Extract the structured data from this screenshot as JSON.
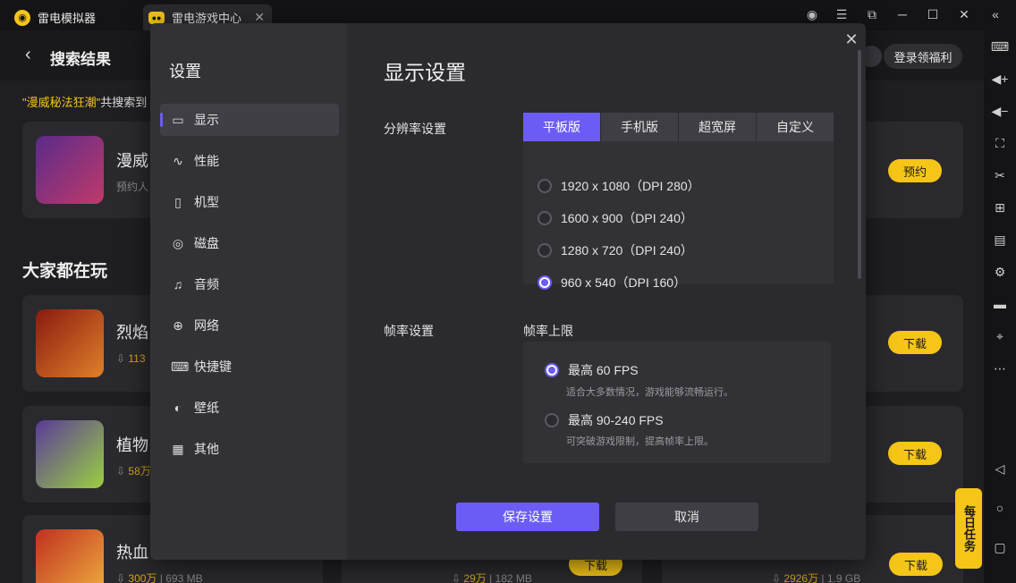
{
  "titlebar": {
    "app_tab": "雷电模拟器",
    "game_tab": "雷电游戏中心",
    "close_glyph": "✕",
    "controls": [
      "account-icon",
      "menu-icon",
      "restore-icon",
      "minimize-icon",
      "maximize-icon",
      "close-icon",
      "collapse-icon"
    ]
  },
  "background": {
    "header_title": "搜索结果",
    "login_label": "登录领福利",
    "search_info_keyword": "\"漫威秘法狂潮\"",
    "search_info_text": "共搜索到",
    "section_title": "大家都在玩",
    "apps": [
      {
        "name": "漫威",
        "sub": "预约人",
        "button": "预约"
      },
      {
        "name": "烈焰",
        "downloads": "113",
        "button": "下载"
      },
      {
        "name": "植物",
        "downloads": "58万",
        "button": "下载"
      },
      {
        "name": "热血",
        "downloads": "300万",
        "size": "693 MB"
      }
    ],
    "bottom_row": [
      {
        "downloads": "29万",
        "size": "182 MB",
        "button": "下载"
      },
      {
        "downloads": "2926万",
        "size": "1.9 GB",
        "button": "下载"
      }
    ],
    "daily_badge": "每日任务"
  },
  "dialog": {
    "sidebar_title": "设置",
    "nav": [
      {
        "label": "显示",
        "icon": "monitor-icon",
        "glyph": "▭"
      },
      {
        "label": "性能",
        "icon": "performance-icon",
        "glyph": "∿"
      },
      {
        "label": "机型",
        "icon": "device-icon",
        "glyph": "▯"
      },
      {
        "label": "磁盘",
        "icon": "disk-icon",
        "glyph": "◎"
      },
      {
        "label": "音频",
        "icon": "audio-icon",
        "glyph": "♫"
      },
      {
        "label": "网络",
        "icon": "globe-icon",
        "glyph": "⊕"
      },
      {
        "label": "快捷键",
        "icon": "keyboard-icon",
        "glyph": "⌨"
      },
      {
        "label": "壁纸",
        "icon": "palette-icon",
        "glyph": "◐"
      },
      {
        "label": "其他",
        "icon": "grid-icon",
        "glyph": "▦"
      }
    ],
    "title": "显示设置",
    "close_glyph": "✕",
    "resolution": {
      "label": "分辨率设置",
      "tabs": [
        "平板版",
        "手机版",
        "超宽屏",
        "自定义"
      ],
      "selected_tab": "平板版",
      "options": [
        {
          "label": "1920 x 1080（DPI 280）",
          "selected": false
        },
        {
          "label": "1600 x 900（DPI 240）",
          "selected": false
        },
        {
          "label": "1280 x 720（DPI 240）",
          "selected": false
        },
        {
          "label": "960 x 540（DPI 160）",
          "selected": true
        }
      ]
    },
    "fps": {
      "label": "帧率设置",
      "cap_label": "帧率上限",
      "options": [
        {
          "label": "最高 60 FPS",
          "desc": "适合大多数情况，游戏能够流畅运行。",
          "selected": true
        },
        {
          "label": "最高 90-240 FPS",
          "desc": "可突破游戏限制，提高帧率上限。",
          "selected": false
        }
      ]
    },
    "save_label": "保存设置",
    "cancel_label": "取消"
  },
  "colors": {
    "accent": "#6b5cf6",
    "brand_yellow": "#f5c518",
    "dialog_bg": "#2b2b2f",
    "sidebar_bg": "#323236"
  }
}
